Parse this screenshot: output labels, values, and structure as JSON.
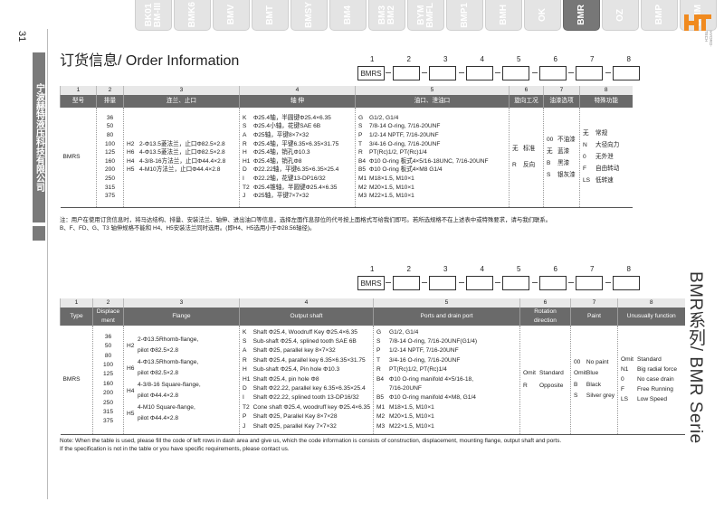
{
  "tabs": [
    "BMM",
    "BMP",
    "OZ",
    "BMR",
    "OK",
    "BMH",
    "BMP1",
    "BYM\nBMFL",
    "BM3\nBM2",
    "BM4",
    "BMSY",
    "BMT",
    "BMV",
    "BMK6",
    "BK01\nBM-III"
  ],
  "active_tab": "BMR",
  "page_number": "31",
  "company_name": "宁波赫特液压科技有限公司",
  "logo": {
    "mark": "HT",
    "sub": "HYDRO-TECH",
    "accent": "#f08a1f"
  },
  "series_label": "BMR系列/ BMR Serie",
  "title": "订货信息/ Order Information",
  "code": {
    "prefix": "BMRS",
    "numbers": [
      "1",
      "2",
      "3",
      "4",
      "5",
      "6",
      "7",
      "8"
    ]
  },
  "cn_table": {
    "col_numbers": [
      "1",
      "2",
      "3",
      "4",
      "5",
      "6",
      "7",
      "8"
    ],
    "header": [
      "型号",
      "排量",
      "连兰、止口",
      "轴 伸",
      "油口、泄油口",
      "旋向工况",
      "油漆选项",
      "特殊功能"
    ],
    "model": "BMRS",
    "displacement": "36\n50\n80\n100\n125\n160\n200\n250\n315\n375",
    "flange_codes": "H2\nH6\nH4\nH5",
    "flange_desc": "2-Φ13.5菱法兰，止口Φ82.5×2.8\n4-Φ13.5菱法兰，止口Φ82.5×2.8\n4-3/8-16方法兰，止口Φ44.4×2.8\n4-M10方法兰，止口Φ44.4×2.8",
    "shaft_codes": "K\nS\nA\nR\nH\nH1\nD\nI\nT2\nJ",
    "shaft_desc": "Φ25.4轴，半圆键Φ25.4×6.35\nΦ25.4小轴，花键SAE 6B\nΦ25轴，平键8×7×32\nΦ25.4轴，平键6.35×6.35×31.75\nΦ25.4轴，销孔Φ10.3\nΦ25.4轴，销孔Φ8\nΦ22.22轴，平键6.35×6.35×25.4\nΦ22.2轴，花键13-DP16/32\nΦ25.4锥轴，半圆键Φ25.4×6.35\nΦ25轴，平键7×7×32",
    "port_codes": "G\nS\nP\nT\nR\nB4\nB5\nM1\nM2\nM3",
    "port_desc": "G1/2, G1/4\n7/8-14 O-ring, 7/16-20UNF\n1/2-14 NPTF, 7/16-20UNF\n3/4-16 O-ring, 7/16-20UNF\nPT(Rc)1/2, PT(Rc)1/4\nΦ10 O-ring 板式4×5/16-18UNC, 7/16-20UNF\nΦ10 O-ring 板式4×M8 G1/4\nM18×1.5, M10×1\nM20×1.5, M10×1\nM22×1.5, M10×1",
    "rot_codes": "无\nR",
    "rot_desc": "标准\n反向",
    "paint_codes": "00\n无\nB\nS",
    "paint_desc": "不油漆\n蓝漆\n黑漆\n银灰漆",
    "func_codes": "无\nN\n0\nF\nLS",
    "func_desc": "常规\n大径向力\n无外泄\n自由转动\n低转速",
    "note": "注：用户在使用订货信息时，将马达结构、排量、安装法兰、轴伸、进出油口等信息，选择左面作息部位的代号按上面格式写给我们即可。若所选规格不在上述表中或特殊要求，请与我们联系。\nB、F、FD、G、T3 轴伸规格不能和 H4、H5安装法兰同时选用。(即H4、H5选用小于Φ28.56轴径)。"
  },
  "en_table": {
    "col_numbers": [
      "1",
      "2",
      "3",
      "4",
      "5",
      "6",
      "7",
      "8"
    ],
    "header": [
      "Type",
      "Displace\nment",
      "Flange",
      "Output shaft",
      "Ports and drain port",
      "Rotation\ndirection",
      "Paint",
      "Unusually function"
    ],
    "model": "BMRS",
    "displacement": "36\n50\n80\n100\n125\n160\n200\n250\n315\n375",
    "flange_codes": "H2\nH6\nH4\nH5",
    "flange_desc": "2-Φ13.5Rhomb-flange,\npilot Φ82.5×2.8\n4-Φ13.5Rhomb-flange,\npilot Φ82.5×2.8\n4-3/8-16 Square-flange,\npilot Φ44.4×2.8\n4-M10 Square-flange,\npilot Φ44.4×2.8",
    "shaft_codes": "K\nS\nA\nR\nH\nH1\nD\nI\nT2\nP\nJ",
    "shaft_desc": "Shaft Φ25.4, Woodruff Key Φ25.4×6.35\nSub-shaft Φ25.4, splined tooth SAE 6B\nShaft Φ25, parallel key 8×7×32\nShaft Φ25.4, parallel key 6.35×6.35×31.75\nSub-shaft Φ25.4, Pin hole Φ10.3\nShaft Φ25.4, pin hole Φ8\nShaft Φ22.22, parallel key 6.35×6.35×25.4\nShaft Φ22.22, splined tooth 13-DP16/32\nCone shaft Φ25.4, woodruff key Φ25.4×6.35\nShaft Φ25, Parallel Key 8×7×28\nShaft Φ25, parallel Key 7×7×32",
    "port_codes": "G\nS\nP\nT\nR\nB4\n\nB5\nM1\nM2\nM3",
    "port_desc": "G1/2, G1/4\n7/8-14 O-ring, 7/16-20UNF(G1/4)\n1/2-14 NPTF, 7/16-20UNF\n3/4-16 O-ring, 7/16-20UNF\nPT(Rc)1/2, PT(Rc)1/4\nΦ10 O-ring manifold 4×5/16-18,\n7/16-20UNF\nΦ10 O-ring manifold 4×M8, G1/4\nM18×1.5, M10×1\nM20×1.5, M10×1\nM22×1.5, M10×1",
    "rot_codes": "Omit\nR",
    "rot_desc": "Standard\nOpposite",
    "paint_codes": "00\nOmit\nB\nS",
    "paint_desc": "No paint\nBlue\nBlack\nSilver grey",
    "func_codes": "Omit\nN1\n0\nF\nLS",
    "func_desc": "Standard\nBig radial force\nNo case drain\nFree Running\nLow Speed",
    "note": "Note: When the table is used, please fill the code of left rows in dash area and give us, which the code information is consists of construction, displacement, mounting flange, output shaft and ports.\nIf the specification is not in the table or you have specific requirements, please contact us."
  }
}
